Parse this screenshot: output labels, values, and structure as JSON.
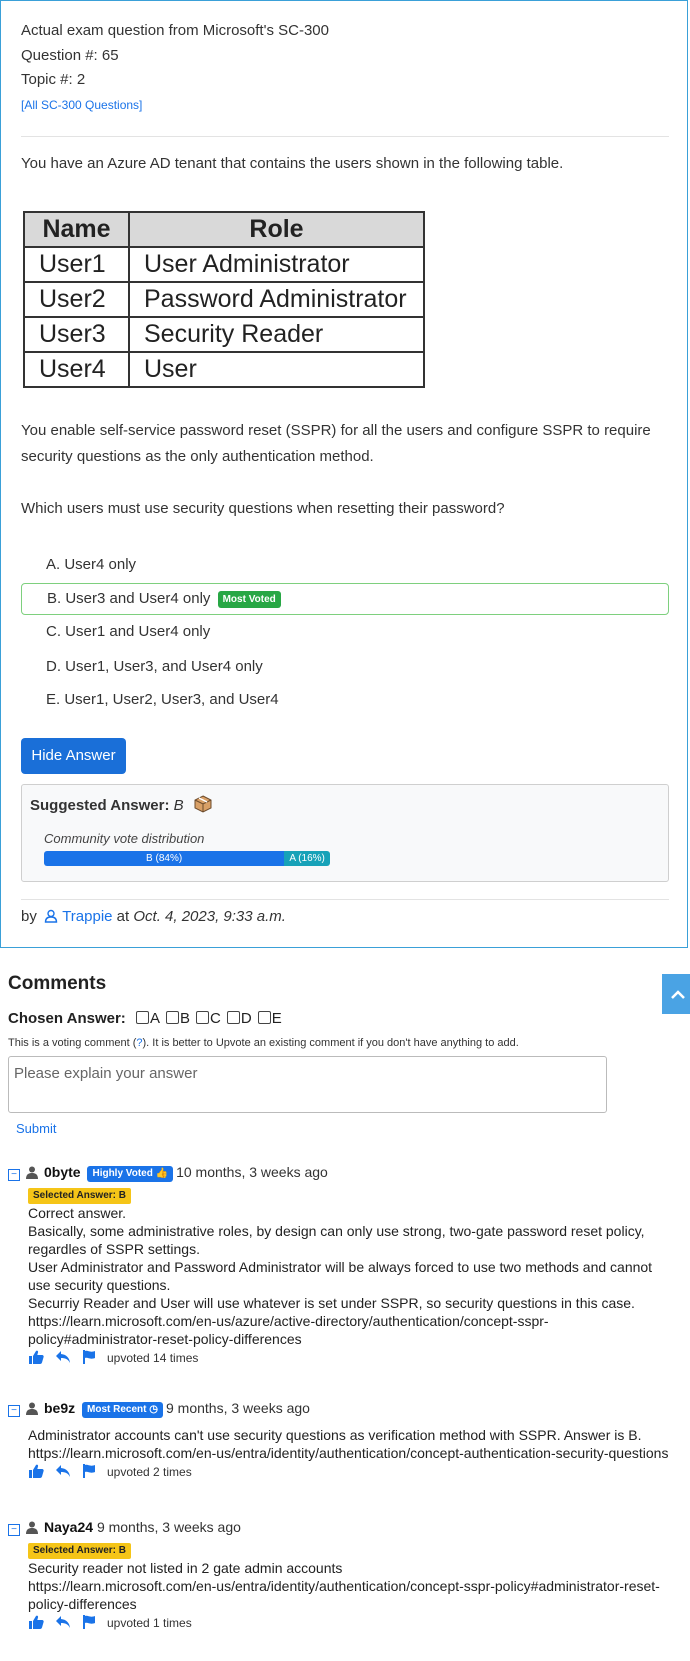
{
  "header": {
    "line1": "Actual exam question from Microsoft's SC-300",
    "line2": "Question #: 65",
    "line3": "Topic #: 2",
    "all_link": "[All SC-300 Questions]"
  },
  "question": {
    "intro": "You have an Azure AD tenant that contains the users shown in the following table.",
    "table": {
      "headers": [
        "Name",
        "Role"
      ],
      "rows": [
        [
          "User1",
          "User Administrator"
        ],
        [
          "User2",
          "Password Administrator"
        ],
        [
          "User3",
          "Security Reader"
        ],
        [
          "User4",
          "User"
        ]
      ]
    },
    "para2": "You enable self-service password reset (SSPR) for all the users and configure SSPR to require security questions as the only authentication method.",
    "prompt": "Which users must use security questions when resetting their password?",
    "choices": [
      "A. User4 only",
      "B. User3 and User4 only",
      "C. User1 and User4 only",
      "D. User1, User3, and User4 only",
      "E. User1, User2, User3, and User4"
    ],
    "most_voted_badge": "Most Voted"
  },
  "answer": {
    "hide_button": "Hide Answer",
    "suggested_label": "Suggested Answer:",
    "suggested_value": "B",
    "dist_label": "Community vote distribution",
    "dist": [
      {
        "label": "B (84%)",
        "percent": 84,
        "color": "#1a73e8"
      },
      {
        "label": "A (16%)",
        "percent": 16,
        "color": "#17a2b8"
      }
    ]
  },
  "byline": {
    "by": "by",
    "user": "Trappie",
    "at": "at",
    "date": "Oct. 4, 2023, 9:33 a.m."
  },
  "comments_section": {
    "title": "Comments",
    "chosen_label": "Chosen Answer:",
    "options": [
      "A",
      "B",
      "C",
      "D",
      "E"
    ],
    "voting_note_pre": "This is a voting comment (",
    "voting_note_q": "?",
    "voting_note_post": "). It is better to Upvote an existing comment if you don't have anything to add.",
    "placeholder": "Please explain your answer",
    "submit": "Submit"
  },
  "comments": [
    {
      "user": "0byte",
      "badge": "Highly Voted",
      "time": "10 months, 3 weeks ago",
      "selected": "Selected Answer: B",
      "body": "Correct answer.\nBasically, some administrative roles, by design can only use strong, two-gate password reset policy, regardles of SSPR settings.\nUser Administrator and Password Administrator will be always forced to use two methods and cannot use security questions.\nSecurriy Reader and User will use whatever is set under SSPR, so security questions in this case.\nhttps://learn.microsoft.com/en-us/azure/active-directory/authentication/concept-sspr-policy#administrator-reset-policy-differences",
      "upvotes": "upvoted 14 times"
    },
    {
      "user": "be9z",
      "badge": "Most Recent",
      "time": "9 months, 3 weeks ago",
      "selected": "",
      "body": "Administrator accounts can't use security questions as verification method with SSPR. Answer is B.\nhttps://learn.microsoft.com/en-us/entra/identity/authentication/concept-authentication-security-questions",
      "upvotes": "upvoted 2 times"
    },
    {
      "user": "Naya24",
      "badge": "",
      "time": "9 months, 3 weeks ago",
      "selected": "Selected Answer: B",
      "body": "Security reader not listed in 2 gate admin accounts\nhttps://learn.microsoft.com/en-us/entra/identity/authentication/concept-sspr-policy#administrator-reset-policy-differences",
      "upvotes": "upvoted 1 times"
    }
  ]
}
